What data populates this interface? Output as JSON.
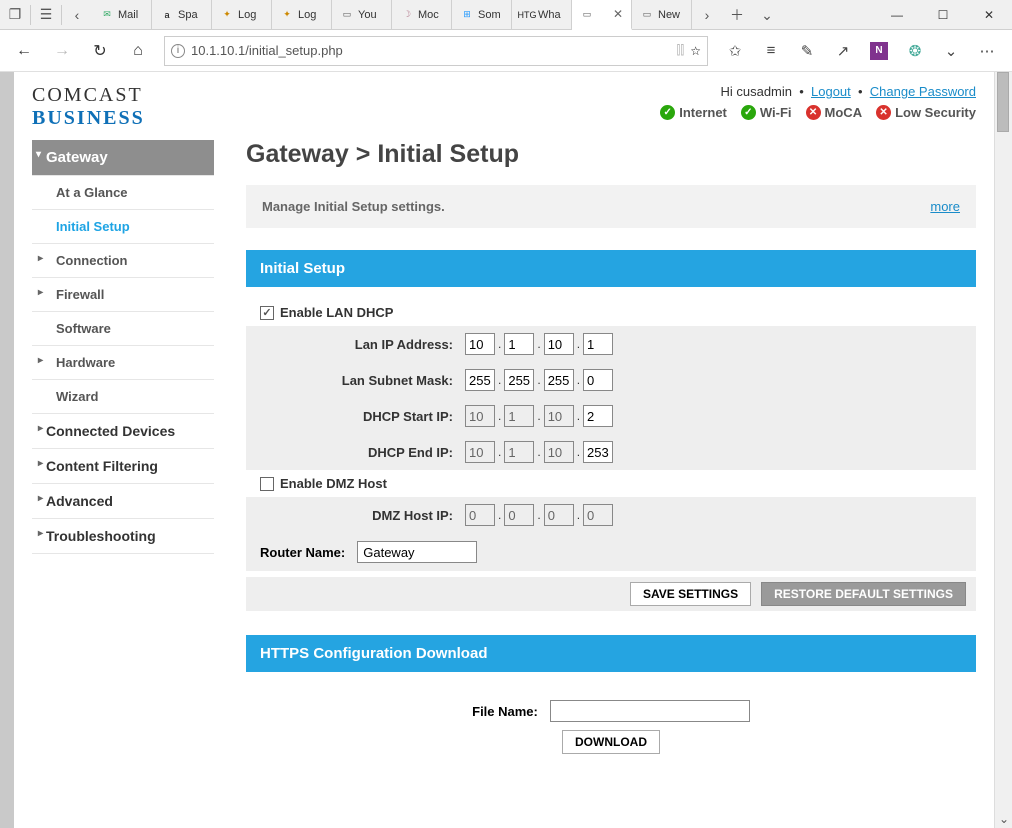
{
  "browser": {
    "tabs": [
      {
        "label": "Mail",
        "favicon_color": "#3a6",
        "favicon_txt": "✉"
      },
      {
        "label": "Spa",
        "favicon_color": "#000",
        "favicon_txt": "a"
      },
      {
        "label": "Log",
        "favicon_color": "#c80",
        "favicon_txt": "✦"
      },
      {
        "label": "Log",
        "favicon_color": "#c80",
        "favicon_txt": "✦"
      },
      {
        "label": "You",
        "favicon_color": "#555",
        "favicon_txt": "▭"
      },
      {
        "label": "Moc",
        "favicon_color": "#b89",
        "favicon_txt": "☽"
      },
      {
        "label": "Som",
        "favicon_color": "#29f",
        "favicon_txt": "⊞"
      },
      {
        "label": "Wha",
        "favicon_color": "#222",
        "favicon_txt": "HTG"
      },
      {
        "label": "",
        "favicon_color": "#555",
        "favicon_txt": "▭",
        "active": true
      },
      {
        "label": "New",
        "favicon_color": "#555",
        "favicon_txt": "▭"
      }
    ],
    "url": "10.1.10.1/initial_setup.php"
  },
  "logo": {
    "line1": "COMCAST",
    "line2": "BUSINESS"
  },
  "user": {
    "greeting": "Hi cusadmin",
    "logout": "Logout",
    "change_pw": "Change Password"
  },
  "status": [
    {
      "label": "Internet",
      "state": "ok"
    },
    {
      "label": "Wi-Fi",
      "state": "ok"
    },
    {
      "label": "MoCA",
      "state": "err"
    },
    {
      "label": "Low Security",
      "state": "err"
    }
  ],
  "sidebar": {
    "header": "Gateway",
    "items": [
      {
        "label": "At a Glance",
        "type": "sub"
      },
      {
        "label": "Initial Setup",
        "type": "sub",
        "active": true
      },
      {
        "label": "Connection",
        "type": "caret"
      },
      {
        "label": "Firewall",
        "type": "caret"
      },
      {
        "label": "Software",
        "type": "sub"
      },
      {
        "label": "Hardware",
        "type": "caret"
      },
      {
        "label": "Wizard",
        "type": "sub"
      }
    ],
    "top": [
      {
        "label": "Connected Devices"
      },
      {
        "label": "Content Filtering"
      },
      {
        "label": "Advanced"
      },
      {
        "label": "Troubleshooting"
      }
    ]
  },
  "page_title": "Gateway > Initial Setup",
  "info_text": "Manage Initial Setup settings.",
  "info_more": "more",
  "panel1": {
    "title": "Initial Setup",
    "enable_dhcp_label": "Enable LAN DHCP",
    "enable_dhcp_checked": true,
    "lan_ip_label": "Lan IP Address:",
    "lan_ip": [
      "10",
      "1",
      "10",
      "1"
    ],
    "subnet_label": "Lan Subnet Mask:",
    "subnet": [
      "255",
      "255",
      "255",
      "0"
    ],
    "dhcp_start_label": "DHCP Start IP:",
    "dhcp_start": [
      "10",
      "1",
      "10",
      "2"
    ],
    "dhcp_end_label": "DHCP End IP:",
    "dhcp_end": [
      "10",
      "1",
      "10",
      "253"
    ],
    "enable_dmz_label": "Enable DMZ Host",
    "enable_dmz_checked": false,
    "dmz_ip_label": "DMZ Host IP:",
    "dmz_ip": [
      "0",
      "0",
      "0",
      "0"
    ],
    "router_name_label": "Router Name:",
    "router_name": "Gateway",
    "save_btn": "SAVE SETTINGS",
    "restore_btn": "RESTORE DEFAULT SETTINGS"
  },
  "panel2": {
    "title": "HTTPS Configuration Download",
    "file_label": "File Name:",
    "download_btn": "DOWNLOAD"
  }
}
